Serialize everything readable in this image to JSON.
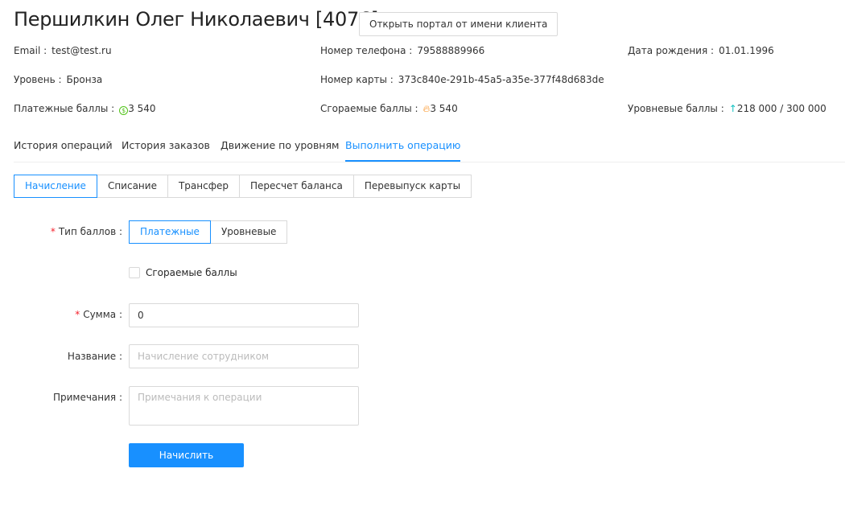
{
  "header": {
    "title": "Першилкин Олег Николаевич [4076]",
    "portal_button": "Открыть портал от имени клиента"
  },
  "info": {
    "email": {
      "label": "Email :",
      "value": "test@test.ru"
    },
    "phone": {
      "label": "Номер телефона :",
      "value": "79588889966"
    },
    "birth": {
      "label": "Дата рождения :",
      "value": "01.01.1996"
    },
    "level": {
      "label": "Уровень :",
      "value": "Бронза"
    },
    "card": {
      "label": "Номер карты :",
      "value": "373c840e-291b-45a5-a35e-377f48d683de"
    },
    "pay_points": {
      "label": "Платежные баллы :",
      "value": "3 540",
      "icon": "dollar-circle-icon",
      "color": "#52c41a"
    },
    "burn_points": {
      "label": "Сгораемые баллы :",
      "value": "3 540",
      "icon": "fire-icon",
      "color": "#fa8c16"
    },
    "level_points": {
      "label": "Уровневые баллы :",
      "value": "218 000 / 300 000",
      "icon": "arrow-up-icon",
      "color": "#13c2c2"
    }
  },
  "tabs": [
    "История операций",
    "История заказов",
    "Движение по уровням",
    "Выполнить операцию"
  ],
  "operations": [
    "Начисление",
    "Списание",
    "Трансфер",
    "Пересчет баланса",
    "Перевыпуск карты"
  ],
  "form": {
    "type_label": "Тип баллов :",
    "types": [
      "Платежные",
      "Уровневые"
    ],
    "burn_checkbox": "Сгораемые баллы",
    "sum_label": "Сумма :",
    "sum_value": "0",
    "name_label": "Название :",
    "name_placeholder": "Начисление сотрудником",
    "note_label": "Примечания :",
    "note_placeholder": "Примечания к операции",
    "submit": "Начислить"
  }
}
